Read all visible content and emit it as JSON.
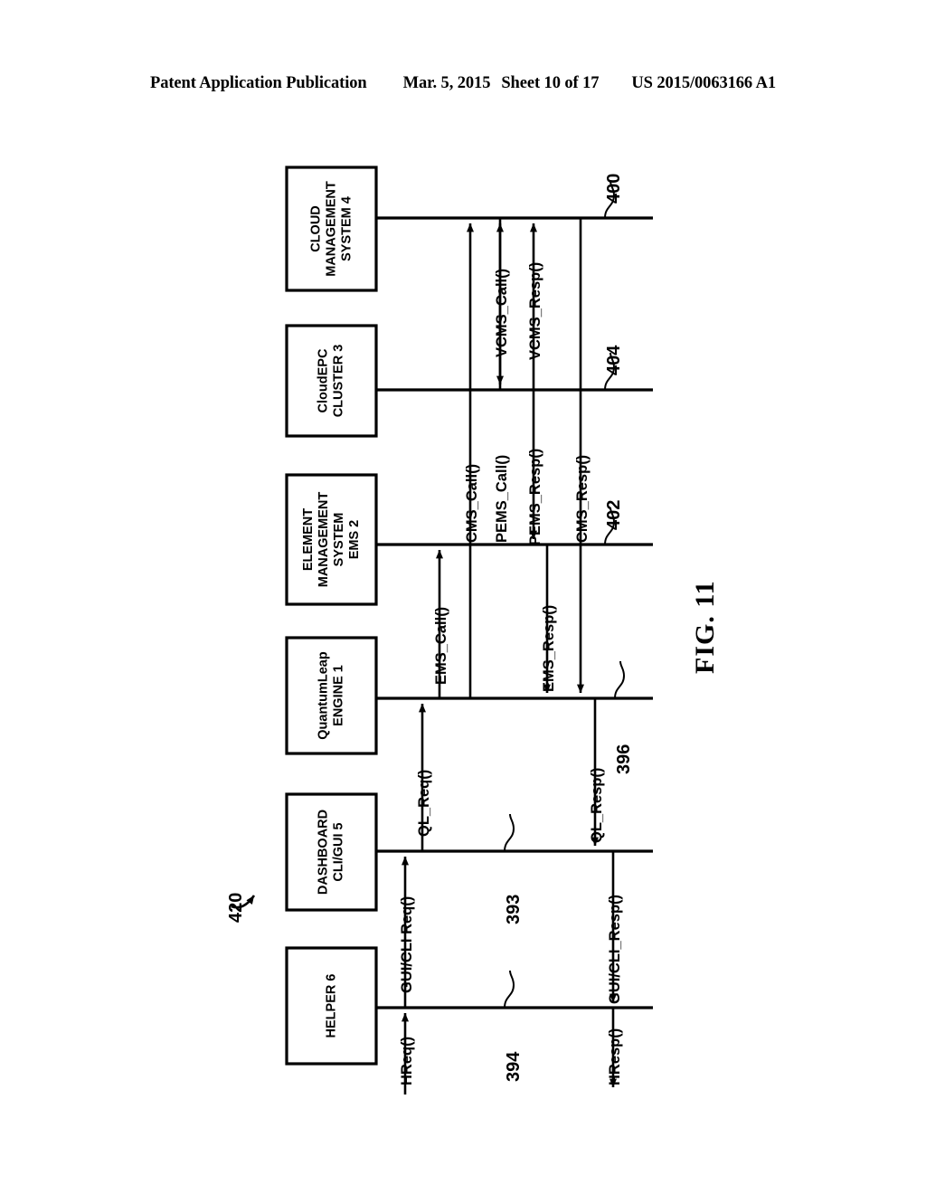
{
  "header": {
    "publication": "Patent Application Publication",
    "date": "Mar. 5, 2015",
    "sheet": "Sheet 10 of 17",
    "patent_number": "US 2015/0063166 A1"
  },
  "figure": {
    "caption": "FIG. 11",
    "diagram_ref": "420"
  },
  "participants": [
    {
      "id": "cms",
      "label": "CLOUD\nMANAGEMENT\nSYSTEM 4",
      "lines": [
        "CLOUD",
        "MANAGEMENT",
        "SYSTEM 4"
      ]
    },
    {
      "id": "cloudepc",
      "label": "CloudEPC\nCLUSTER 3",
      "lines": [
        "CloudEPC",
        "CLUSTER 3"
      ]
    },
    {
      "id": "ems",
      "label": "ELEMENT\nMANAGEMENT\nSYSTEM\nEMS 2",
      "lines": [
        "ELEMENT",
        "MANAGEMENT",
        "SYSTEM",
        "EMS 2"
      ]
    },
    {
      "id": "ql",
      "label": "QuantumLeap\nENGINE 1",
      "lines": [
        "QuantumLeap",
        "ENGINE 1"
      ]
    },
    {
      "id": "dashboard",
      "label": "DASHBOARD\nCLI/GUI 5",
      "lines": [
        "DASHBOARD",
        "CLI/GUI 5"
      ]
    },
    {
      "id": "helper",
      "label": "HELPER 6",
      "lines": [
        "HELPER 6"
      ]
    }
  ],
  "messages": [
    {
      "id": "hreq",
      "label": "HReq()"
    },
    {
      "id": "guicli_req",
      "label": "GUI/CLI Req()"
    },
    {
      "id": "ql_req",
      "label": "QL_Req()"
    },
    {
      "id": "ems_call",
      "label": "EMS_Call()"
    },
    {
      "id": "cms_call",
      "label": "CMS_Call()"
    },
    {
      "id": "pems_call",
      "label": "PEMS_Call()"
    },
    {
      "id": "vcms_call",
      "label": "VCMS_Call()"
    },
    {
      "id": "vcms_resp",
      "label": "VCMS_Resp()"
    },
    {
      "id": "pems_resp",
      "label": "PEMS_Resp()"
    },
    {
      "id": "cms_resp",
      "label": "CMS_Resp()"
    },
    {
      "id": "ems_resp",
      "label": "EMS_Resp()"
    },
    {
      "id": "ql_resp",
      "label": "QL_Resp()"
    },
    {
      "id": "guicli_resp",
      "label": "GUI/CLI_Resp()"
    },
    {
      "id": "hresp",
      "label": "HResp()"
    }
  ],
  "reference_numerals": [
    {
      "id": "ref400",
      "value": "400"
    },
    {
      "id": "ref404",
      "value": "404"
    },
    {
      "id": "ref402",
      "value": "402"
    },
    {
      "id": "ref396",
      "value": "396"
    },
    {
      "id": "ref393",
      "value": "393"
    },
    {
      "id": "ref394",
      "value": "394"
    },
    {
      "id": "ref420",
      "value": "420"
    }
  ],
  "colors": {
    "ink": "#000000",
    "paper": "#ffffff"
  }
}
